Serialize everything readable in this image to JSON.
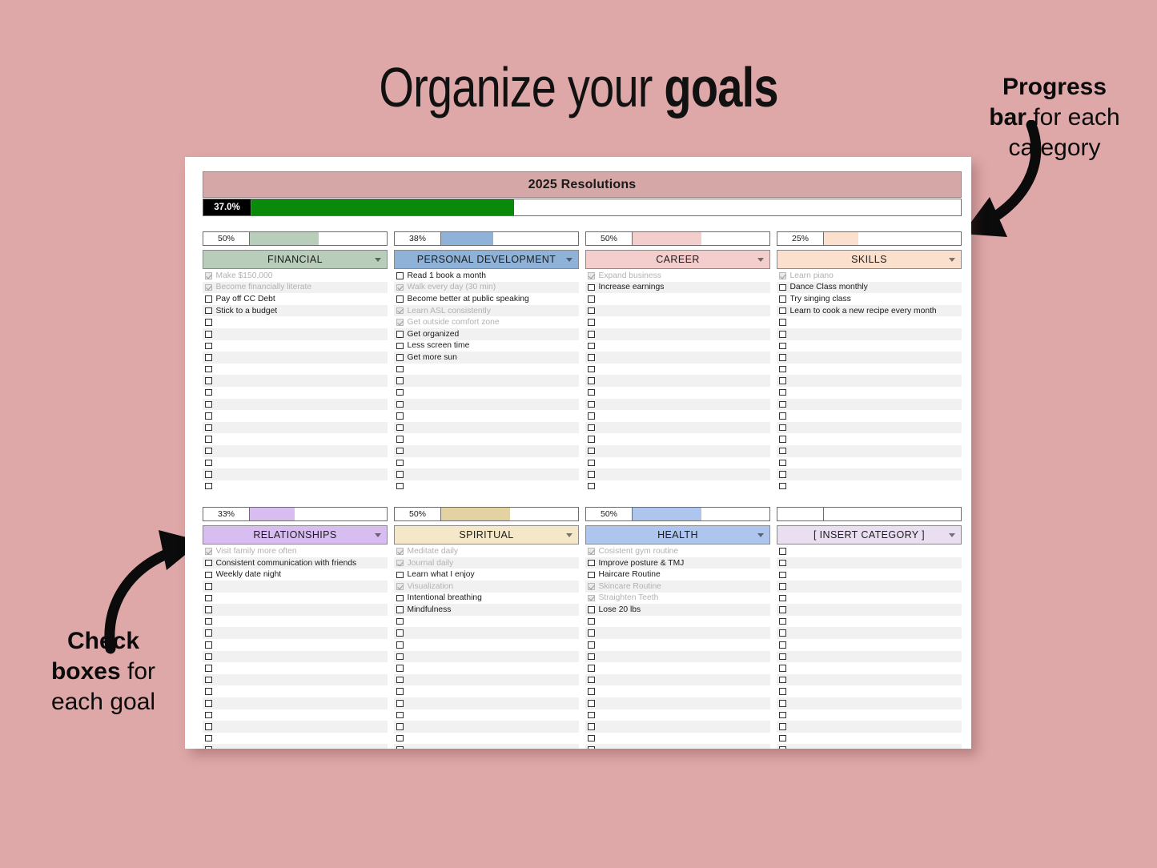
{
  "headline": {
    "plain": "Organize your ",
    "bold": "goals"
  },
  "annotations": {
    "progress": {
      "bold": "Progress bar",
      "rest": " for each category",
      "line1_b": "Progress",
      "line2_b": "bar",
      "line2_rest": " for each",
      "line3": "category"
    },
    "checkboxes": {
      "line1_b": "Check",
      "line2_b": "boxes",
      "line2_rest": " for",
      "line3": "each goal"
    }
  },
  "spreadsheet": {
    "title": "2025 Resolutions",
    "master_progress": {
      "label": "37.0%",
      "percent": 37.0,
      "fill_color": "#0a8a0a",
      "label_bg": "#000000"
    },
    "header_color": "#d6a7a7",
    "categories": [
      {
        "name": "FINANCIAL",
        "percent_label": "50%",
        "percent": 50,
        "color": "#b9cdbb",
        "meter_color": "#b9cdbb",
        "total_rows": 19,
        "items": [
          {
            "text": "Make $150,000",
            "done": true
          },
          {
            "text": "Become financially literate",
            "done": true
          },
          {
            "text": "Pay off CC Debt",
            "done": false
          },
          {
            "text": "Stick to a budget",
            "done": false
          }
        ]
      },
      {
        "name": "PERSONAL DEVELOPMENT",
        "percent_label": "38%",
        "percent": 38,
        "color": "#8fb2d8",
        "meter_color": "#8fb2d8",
        "total_rows": 19,
        "items": [
          {
            "text": "Read 1 book a month",
            "done": false
          },
          {
            "text": "Walk every day (30 min)",
            "done": true
          },
          {
            "text": "Become better at public speaking",
            "done": false
          },
          {
            "text": "Learn ASL consistently",
            "done": true
          },
          {
            "text": "Get outside comfort zone",
            "done": true
          },
          {
            "text": "Get organized",
            "done": false
          },
          {
            "text": "Less screen time",
            "done": false
          },
          {
            "text": "Get more sun",
            "done": false
          }
        ]
      },
      {
        "name": "CAREER",
        "percent_label": "50%",
        "percent": 50,
        "color": "#f4cdcd",
        "meter_color": "#f4cdcd",
        "total_rows": 19,
        "items": [
          {
            "text": "Expand business",
            "done": true
          },
          {
            "text": "Increase earnings",
            "done": false
          }
        ]
      },
      {
        "name": "SKILLS",
        "percent_label": "25%",
        "percent": 25,
        "color": "#fbe0cd",
        "meter_color": "#fbe0cd",
        "total_rows": 19,
        "items": [
          {
            "text": "Learn piano",
            "done": true
          },
          {
            "text": "Dance Class monthly",
            "done": false
          },
          {
            "text": "Try singing class",
            "done": false
          },
          {
            "text": "Learn to cook a new recipe every month",
            "done": false
          }
        ]
      },
      {
        "name": "RELATIONSHIPS",
        "percent_label": "33%",
        "percent": 33,
        "color": "#d8bdf0",
        "meter_color": "#d8bdf0",
        "total_rows": 19,
        "items": [
          {
            "text": "Visit family more often",
            "done": true
          },
          {
            "text": "Consistent communication with friends",
            "done": false
          },
          {
            "text": "Weekly date night",
            "done": false
          }
        ]
      },
      {
        "name": "SPIRITUAL",
        "percent_label": "50%",
        "percent": 50,
        "color": "#f5e8c8",
        "meter_color": "#e3d3a2",
        "total_rows": 19,
        "items": [
          {
            "text": "Meditate daily",
            "done": true
          },
          {
            "text": "Journal daily",
            "done": true
          },
          {
            "text": "Learn what I enjoy",
            "done": false
          },
          {
            "text": "Visualization",
            "done": true
          },
          {
            "text": "Intentional breathing",
            "done": false
          },
          {
            "text": "Mindfulness",
            "done": false
          }
        ]
      },
      {
        "name": "HEALTH",
        "percent_label": "50%",
        "percent": 50,
        "color": "#aec6ee",
        "meter_color": "#aec6ee",
        "total_rows": 19,
        "items": [
          {
            "text": "Cosistent gym routine",
            "done": true
          },
          {
            "text": "Improve posture & TMJ",
            "done": false
          },
          {
            "text": "Haircare Routine",
            "done": false
          },
          {
            "text": "Skincare Routine",
            "done": true
          },
          {
            "text": "Straighten Teeth",
            "done": true
          },
          {
            "text": "Lose 20 lbs",
            "done": false
          }
        ]
      },
      {
        "name": "[ INSERT CATEGORY ]",
        "percent_label": "",
        "percent": 0,
        "color": "#e9dff0",
        "meter_color": "#e9dff0",
        "total_rows": 19,
        "items": []
      }
    ]
  }
}
